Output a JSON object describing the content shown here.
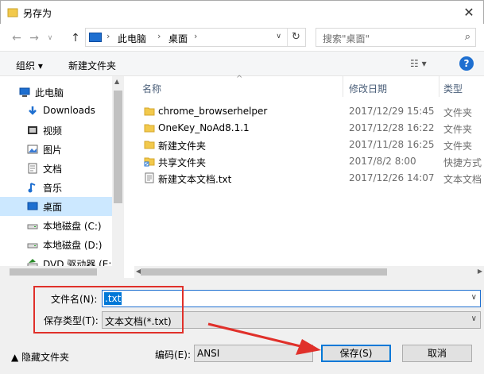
{
  "window": {
    "title": "另存为",
    "close_glyph": "✕"
  },
  "nav": {
    "breadcrumbs": [
      "此电脑",
      "桌面"
    ],
    "search_placeholder": "搜索\"桌面\""
  },
  "toolbar": {
    "organize": "组织 ▾",
    "new_folder": "新建文件夹",
    "view_glyph": "☷ ▾",
    "help": "?"
  },
  "sidebar": {
    "items": [
      {
        "label": "此电脑",
        "icon": "pc-icon",
        "indent": 0
      },
      {
        "label": "Downloads",
        "icon": "download-icon",
        "indent": 1
      },
      {
        "label": "视频",
        "icon": "video-icon",
        "indent": 1
      },
      {
        "label": "图片",
        "icon": "picture-icon",
        "indent": 1
      },
      {
        "label": "文档",
        "icon": "document-icon",
        "indent": 1
      },
      {
        "label": "音乐",
        "icon": "music-icon",
        "indent": 1
      },
      {
        "label": "桌面",
        "icon": "desktop-icon",
        "indent": 1,
        "selected": true
      },
      {
        "label": "本地磁盘 (C:)",
        "icon": "drive-icon",
        "indent": 1
      },
      {
        "label": "本地磁盘 (D:)",
        "icon": "drive-icon",
        "indent": 1
      },
      {
        "label": "DVD 驱动器 (E:)",
        "icon": "dvd-icon",
        "indent": 1
      }
    ]
  },
  "columns": {
    "name": "名称",
    "date": "修改日期",
    "type": "类型"
  },
  "files": [
    {
      "name": "chrome_browserhelper",
      "date": "2017/12/29 15:45",
      "type": "文件夹",
      "icon": "folder-icon"
    },
    {
      "name": "OneKey_NoAd8.1.1",
      "date": "2017/12/28 16:22",
      "type": "文件夹",
      "icon": "folder-icon"
    },
    {
      "name": "新建文件夹",
      "date": "2017/11/28 16:25",
      "type": "文件夹",
      "icon": "folder-icon"
    },
    {
      "name": "共享文件夹",
      "date": "2017/8/2 8:00",
      "type": "快捷方式",
      "icon": "shortcut-icon"
    },
    {
      "name": "新建文本文档.txt",
      "date": "2017/12/26 14:07",
      "type": "文本文档",
      "icon": "text-file-icon"
    }
  ],
  "form": {
    "filename_label": "文件名(N):",
    "filename_value": ".txt",
    "filetype_label": "保存类型(T):",
    "filetype_value": "文本文档(*.txt)",
    "encoding_label": "编码(E):",
    "encoding_value": "ANSI",
    "hide_folders": "▲ 隐藏文件夹",
    "save": "保存(S)",
    "cancel": "取消"
  },
  "colors": {
    "accent": "#0078d7",
    "highlight_box": "#e0302a",
    "selected_bg": "#cce8ff"
  }
}
